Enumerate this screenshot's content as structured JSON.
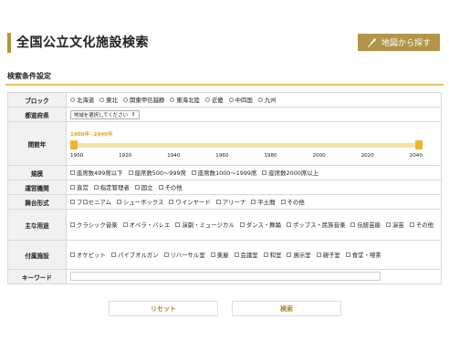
{
  "page": {
    "title": "全国公立文化施設検索",
    "map_button_label": "地図から探す",
    "section_title": "検索条件設定"
  },
  "colors": {
    "accent": "#b8962e",
    "divider": "#e9c45d",
    "slider": "#f0b42f"
  },
  "form": {
    "block": {
      "label": "ブロック",
      "options": [
        "北海道",
        "東北",
        "関東甲信越静",
        "東海北陸",
        "近畿",
        "中四国",
        "九州"
      ]
    },
    "prefecture": {
      "label": "都道府県",
      "selected": "地域を選択してください"
    },
    "year": {
      "label": "開館年",
      "range_text": "1900年 -2040年",
      "min": 1900,
      "max": 2040,
      "low": 1900,
      "high": 2040,
      "ticks": [
        "1900",
        "1920",
        "1940",
        "1960",
        "1980",
        "2000",
        "2020",
        "2040"
      ]
    },
    "scale": {
      "label": "規模",
      "options": [
        "座席数499席以下",
        "座席数500〜999席",
        "座席数1000〜1999席",
        "座席数2000席以上"
      ]
    },
    "operation": {
      "label": "運営機関",
      "options": [
        "直営",
        "指定管理者",
        "国立",
        "その他"
      ]
    },
    "stage": {
      "label": "舞台形式",
      "options": [
        "プロセニアム",
        "シューボックス",
        "ワインヤード",
        "アリーナ",
        "平土間",
        "その他"
      ]
    },
    "usage": {
      "label": "主な用途",
      "options": [
        "クラシック音楽",
        "オペラ・バレエ",
        "演劇・ミュージカル",
        "ダンス・舞踊",
        "ポップス・民族音楽",
        "伝統芸能",
        "演芸",
        "その他"
      ]
    },
    "facilities": {
      "label": "付属施設",
      "options": [
        "オケピット",
        "パイプオルガン",
        "リハーサル室",
        "楽屋",
        "会議室",
        "和室",
        "展示室",
        "親子室",
        "食堂・喫茶"
      ]
    },
    "keyword": {
      "label": "キーワード",
      "value": ""
    }
  },
  "buttons": {
    "reset": "リセット",
    "search": "検索"
  }
}
